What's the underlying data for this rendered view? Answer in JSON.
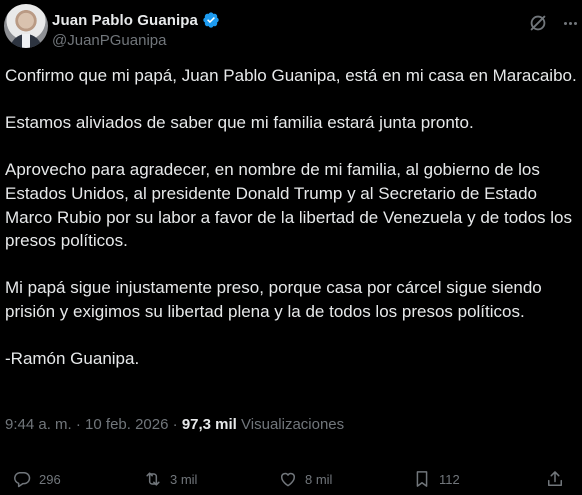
{
  "author": {
    "display_name": "Juan Pablo Guanipa",
    "handle": "@JuanPGuanipa",
    "verified": true
  },
  "post": {
    "paragraphs": [
      "Confirmo que mi papá, Juan Pablo Guanipa, está en mi casa en Maracaibo.",
      "Estamos aliviados de saber que mi familia estará junta pronto.",
      "Aprovecho para agradecer, en nombre de mi familia, al gobierno de los Estados Unidos, al presidente Donald Trump y al Secretario de Estado Marco Rubio por su labor a favor de la libertad de Venezuela y de todos los presos políticos.",
      "Mi papá sigue injustamente preso, porque casa por cárcel sigue siendo prisión y exigimos su libertad plena y la de todos los presos políticos.",
      "-Ramón Guanipa."
    ],
    "time": "9:44 a. m.",
    "separator": "·",
    "date": "10 feb. 2026",
    "views_count": "97,3 mil",
    "views_label": "Visualizaciones"
  },
  "actions": {
    "replies": "296",
    "reposts": "3 mil",
    "likes": "8 mil",
    "bookmarks": "112"
  },
  "icons": {
    "verified": "verified-badge-icon",
    "grok": "grok-icon",
    "more": "more-icon",
    "reply": "reply-icon",
    "repost": "repost-icon",
    "like": "like-icon",
    "bookmark": "bookmark-icon",
    "share": "share-icon"
  },
  "colors": {
    "background": "#000000",
    "text": "#e7e9ea",
    "muted": "#71767b",
    "verified_blue": "#1d9bf0"
  }
}
